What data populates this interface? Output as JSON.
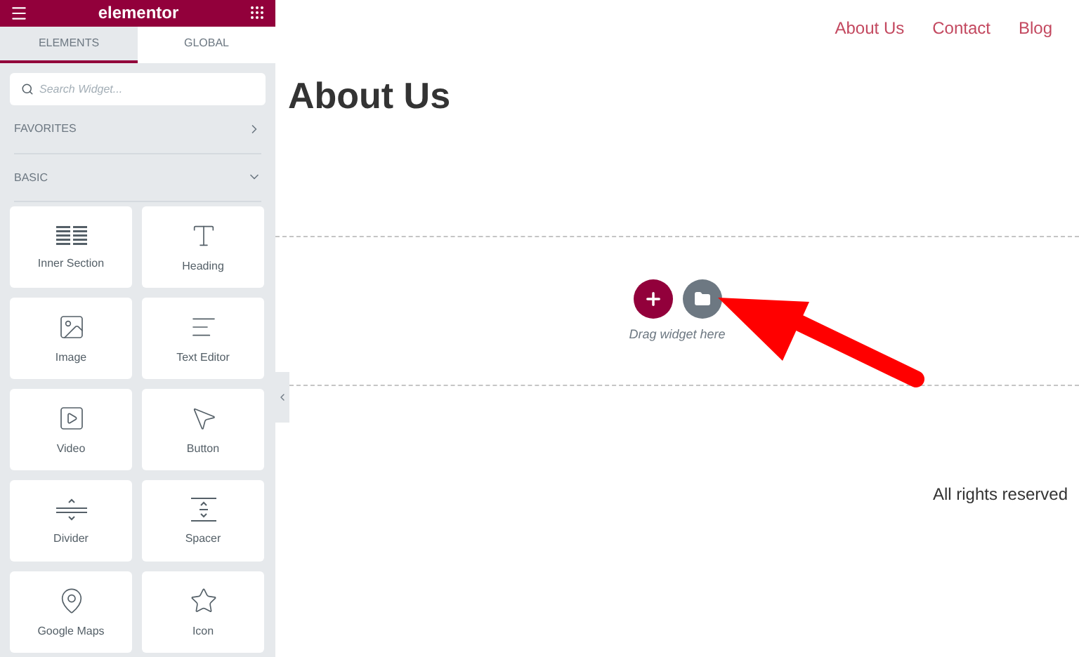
{
  "sidebar": {
    "logo": "elementor",
    "tabs": [
      {
        "label": "ELEMENTS",
        "selected": true
      },
      {
        "label": "GLOBAL",
        "selected": false
      }
    ],
    "search": {
      "placeholder": "Search Widget..."
    },
    "sections": [
      {
        "label": "FAVORITES",
        "expanded": false
      },
      {
        "label": "BASIC",
        "expanded": true
      }
    ],
    "widgets": [
      {
        "label": "Inner Section"
      },
      {
        "label": "Heading"
      },
      {
        "label": "Image"
      },
      {
        "label": "Text Editor"
      },
      {
        "label": "Video"
      },
      {
        "label": "Button"
      },
      {
        "label": "Divider"
      },
      {
        "label": "Spacer"
      },
      {
        "label": "Google Maps"
      },
      {
        "label": "Icon"
      }
    ]
  },
  "nav": [
    "About Us",
    "Contact",
    "Blog"
  ],
  "page_title": "About Us",
  "drop_zone": {
    "hint": "Drag widget here"
  },
  "footer": "All rights reserved"
}
